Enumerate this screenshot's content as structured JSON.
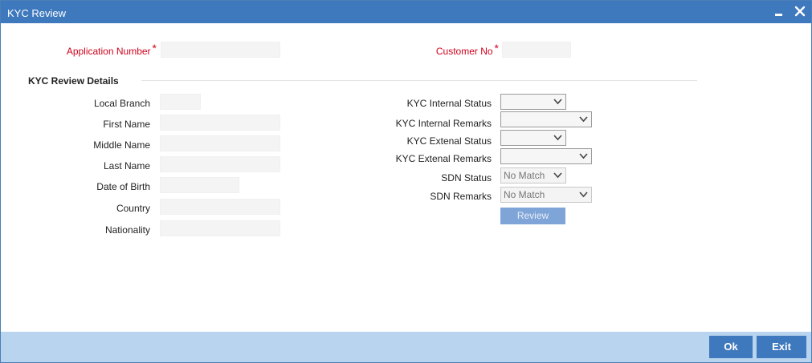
{
  "window": {
    "title": "KYC Review"
  },
  "header": {
    "application_number_label": "Application Number",
    "application_number_value": "",
    "customer_no_label": "Customer No",
    "customer_no_value": "",
    "required_mark": "*"
  },
  "section": {
    "title": "KYC Review Details"
  },
  "left_fields": [
    {
      "label": "Local Branch",
      "value": ""
    },
    {
      "label": "First Name",
      "value": ""
    },
    {
      "label": "Middle Name",
      "value": ""
    },
    {
      "label": "Last Name",
      "value": ""
    },
    {
      "label": "Date of Birth",
      "value": ""
    },
    {
      "label": "Country",
      "value": ""
    },
    {
      "label": "Nationality",
      "value": ""
    }
  ],
  "right_fields": [
    {
      "label": "KYC Internal Status",
      "value": ""
    },
    {
      "label": "KYC Internal Remarks",
      "value": ""
    },
    {
      "label": "KYC Extenal Status",
      "value": ""
    },
    {
      "label": "KYC Extenal Remarks",
      "value": ""
    },
    {
      "label": "SDN Status",
      "value": "No Match"
    },
    {
      "label": "SDN Remarks",
      "value": "No Match"
    }
  ],
  "buttons": {
    "review": "Review",
    "ok": "Ok",
    "exit": "Exit"
  },
  "colors": {
    "titlebar": "#3e78bd",
    "footer": "#b8d4ee",
    "required": "#d0021b",
    "review_button": "#7fa5d8"
  }
}
